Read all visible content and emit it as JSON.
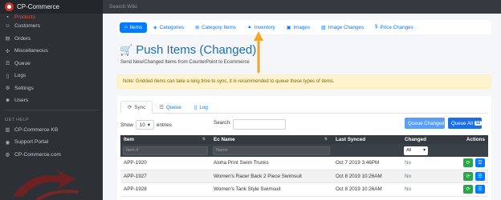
{
  "brand": {
    "name": "CP-Commerce"
  },
  "sidebar": {
    "items": [
      {
        "label": "Products",
        "icon": "box-icon"
      },
      {
        "label": "Customers",
        "icon": "users-icon"
      },
      {
        "label": "Orders",
        "icon": "receipt-icon"
      },
      {
        "label": "Miscellaneous",
        "icon": "misc-icon"
      },
      {
        "label": "Queue",
        "icon": "queue-icon"
      },
      {
        "label": "Logs",
        "icon": "log-icon"
      },
      {
        "label": "Settings",
        "icon": "gear-icon"
      },
      {
        "label": "Users",
        "icon": "user-icon"
      }
    ],
    "help_section": "GET HELP",
    "help_items": [
      {
        "label": "CP-Commerce KB",
        "icon": "book-icon"
      },
      {
        "label": "Support Portal",
        "icon": "support-icon"
      },
      {
        "label": "CP-Commerce.com",
        "icon": "globe-icon"
      }
    ]
  },
  "topbar": {
    "search_placeholder": "Search Wiki"
  },
  "tabs": [
    {
      "label": "Items",
      "icon": "home-icon",
      "active": true
    },
    {
      "label": "Categories",
      "icon": "tag-icon"
    },
    {
      "label": "Category Items",
      "icon": "sitemap-icon"
    },
    {
      "label": "Inventory",
      "icon": "warehouse-icon"
    },
    {
      "label": "Images",
      "icon": "image-icon"
    },
    {
      "label": "Image Changes",
      "icon": "images-icon"
    },
    {
      "label": "Price Changes",
      "icon": "dollar-icon"
    }
  ],
  "page": {
    "title": "Push Items (Changed)",
    "subtitle": "Send New/Changed Items from CounterPoint to Ecommerce",
    "note": "Note: Gridded items can take a long time to sync, it is recommended to queue these types of items."
  },
  "subtabs": [
    {
      "label": "Sync",
      "icon": "sync-icon",
      "active": true
    },
    {
      "label": "Queue",
      "icon": "queue-icon"
    },
    {
      "label": "Log",
      "icon": "file-icon"
    }
  ],
  "controls": {
    "show_label": "Show",
    "page_size": "10",
    "entries_label": "entries",
    "search_label": "Search:",
    "queue_changed": "Queue Changed",
    "queue_all": "Queue All",
    "queue_all_badge": "52"
  },
  "table": {
    "headers": [
      "Item",
      "Ec Name",
      "Last Synced",
      "Changed",
      "Actions"
    ],
    "filter_item_placeholder": "Item #",
    "filter_name_placeholder": "Name",
    "filter_changed_value": "All",
    "rows": [
      {
        "item": "APP-1920",
        "name": "Aloha Print Swim Trunks",
        "synced": "Oct 7 2019 3:46PM",
        "changed": "No"
      },
      {
        "item": "APP-1927",
        "name": "Women's Racer Back 2 Piece Swimsuit",
        "synced": "Oct 8 2019 10:26AM",
        "changed": "No"
      },
      {
        "item": "APP-1928",
        "name": "Women's Tank Style Swimsuit",
        "synced": "Oct 8 2019 10:26AM",
        "changed": "No"
      }
    ]
  },
  "colors": {
    "primary": "#007bff",
    "sidebar": "#2d3136",
    "accent": "#e74c3c",
    "arrow": "#f5a623"
  }
}
